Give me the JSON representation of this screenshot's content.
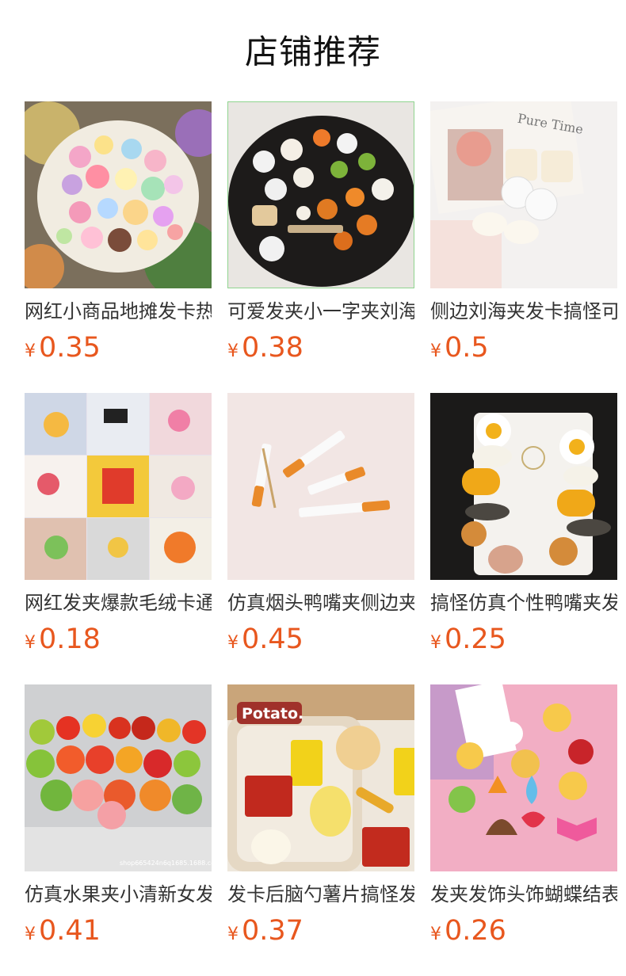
{
  "page": {
    "title": "店铺推荐"
  },
  "colors": {
    "price": "#e8571e",
    "text": "#333333",
    "title": "#111111"
  },
  "products": [
    {
      "name": "网红小商品地摊发卡热卖",
      "currency": "¥",
      "price": "0.35",
      "image_icon": "hair-clips-pile-photo"
    },
    {
      "name": "可爱发夹小一字夹刘海夹",
      "currency": "¥",
      "price": "0.38",
      "image_icon": "food-clips-black-plate-photo"
    },
    {
      "name": "侧边刘海夹发卡搞怪可爱",
      "currency": "¥",
      "price": "0.5",
      "image_icon": "bun-dumpling-clips-photo"
    },
    {
      "name": "网红发夹爆款毛绒卡通",
      "currency": "¥",
      "price": "0.18",
      "image_icon": "collage-clips-photo"
    },
    {
      "name": "仿真烟头鸭嘴夹侧边夹子",
      "currency": "¥",
      "price": "0.45",
      "image_icon": "cigarette-clips-photo"
    },
    {
      "name": "搞怪仿真个性鸭嘴夹发卡",
      "currency": "¥",
      "price": "0.25",
      "image_icon": "egg-corn-burger-clips-photo"
    },
    {
      "name": "仿真水果夹小清新女发卡",
      "currency": "¥",
      "price": "0.41",
      "image_icon": "fruit-clips-photo"
    },
    {
      "name": "发卡后脑勺薯片搞怪发夹",
      "currency": "¥",
      "price": "0.37",
      "image_icon": "potato-chips-clips-photo"
    },
    {
      "name": "发夹发饰头饰蝴蝶结表情",
      "currency": "¥",
      "price": "0.26",
      "image_icon": "emoji-clips-photo"
    }
  ],
  "image_text": {
    "potato_logo": "Potato.",
    "watermark": "shop665424n6q1685.1688.com",
    "card_text": "Pure Time"
  }
}
